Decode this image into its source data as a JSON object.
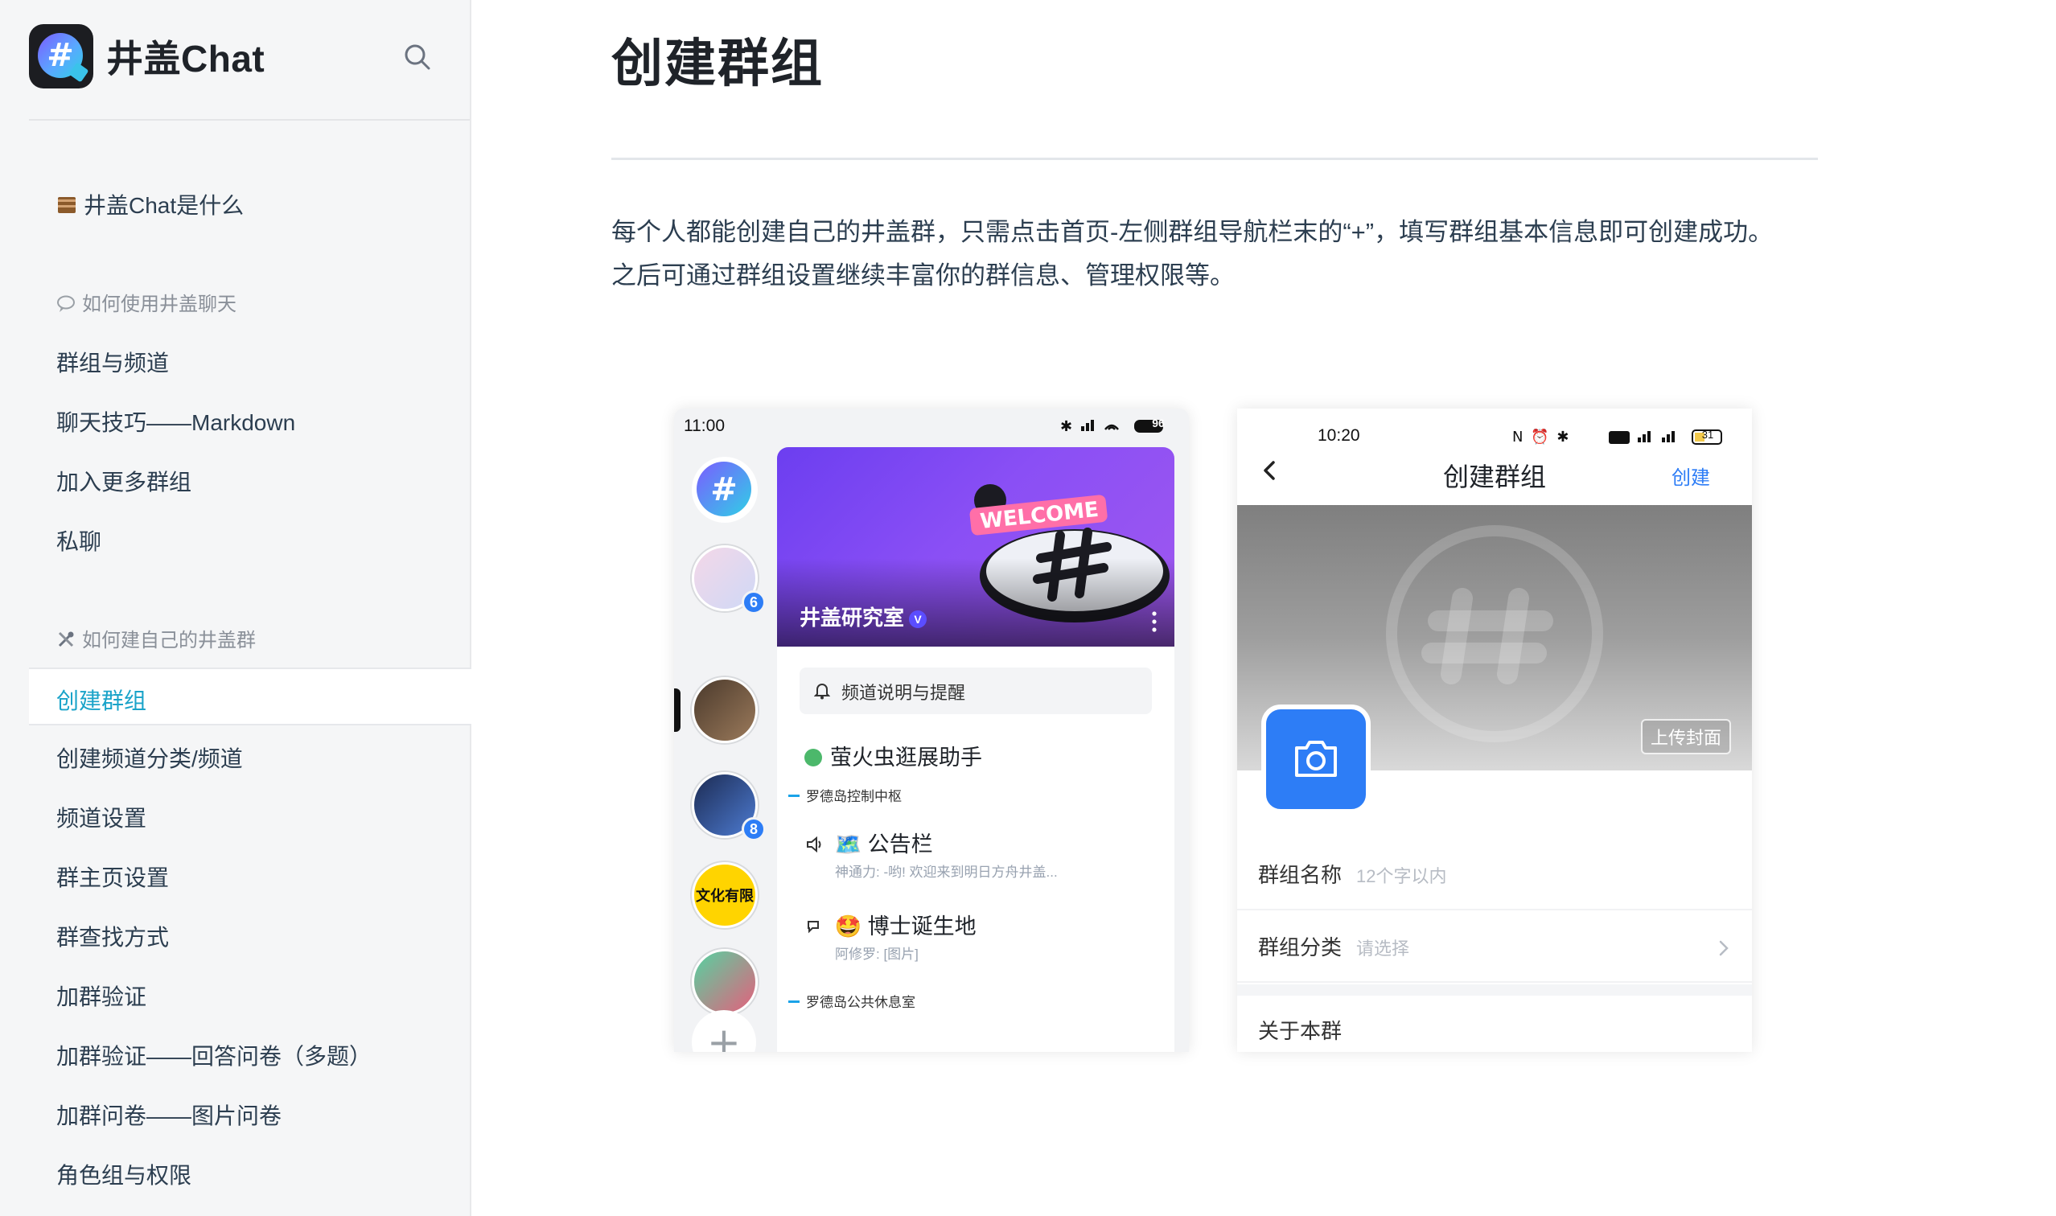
{
  "app": {
    "name": "井盖Chat"
  },
  "sidebar": {
    "intro": {
      "emoji": "🟫",
      "label": "井盖Chat是什么"
    },
    "sections": [
      {
        "emoji": "💬",
        "title": "如何使用井盖聊天",
        "items": [
          "群组与频道",
          "聊天技巧——Markdown",
          "加入更多群组",
          "私聊"
        ]
      },
      {
        "emoji": "🛠",
        "title": "如何建自己的井盖群",
        "items": [
          "创建群组",
          "创建频道分类/频道",
          "频道设置",
          "群主页设置",
          "群查找方式",
          "加群验证",
          "加群验证——回答问卷（多题）",
          "加群问卷——图片问卷",
          "角色组与权限"
        ]
      }
    ],
    "active": "创建群组"
  },
  "article": {
    "title": "创建群组",
    "paragraph_line1": "每个人都能创建自己的井盖群，只需点击首页-左侧群组导航栏末的“+”，填写群组基本信息即可创建成功。",
    "paragraph_line2": "之后可通过群组设置继续丰富你的群信息、管理权限等。"
  },
  "phone_a": {
    "time": "11:00",
    "battery": "96",
    "badges": [
      "6",
      "8"
    ],
    "server_label": "文化有限",
    "banner_text": "WELCOME",
    "group_name": "井盖研究室",
    "verified_mark": "V",
    "notice": "频道说明与提醒",
    "bot": "萤火虫逛展助手",
    "category1": "罗德岛控制中枢",
    "channels": [
      {
        "emoji": "🗺️",
        "name": "公告栏",
        "preview": "神通力: -哟! 欢迎来到明日方舟井盖..."
      },
      {
        "emoji": "🤩",
        "name": "博士诞生地",
        "preview": "阿修罗: [图片]"
      }
    ],
    "category2": "罗德岛公共休息室",
    "add_symbol": "+"
  },
  "phone_b": {
    "time": "10:20",
    "battery": "31",
    "title": "创建群组",
    "create_label": "创建",
    "upload_cover": "上传封面",
    "fields": [
      {
        "label": "群组名称",
        "placeholder": "12个字以内"
      },
      {
        "label": "群组分类",
        "placeholder": "请选择"
      }
    ],
    "about": "关于本群"
  },
  "colors": {
    "accent": "#1aa3c9",
    "phone_blue": "#2d7df6",
    "callout": "#1aa3e8"
  }
}
